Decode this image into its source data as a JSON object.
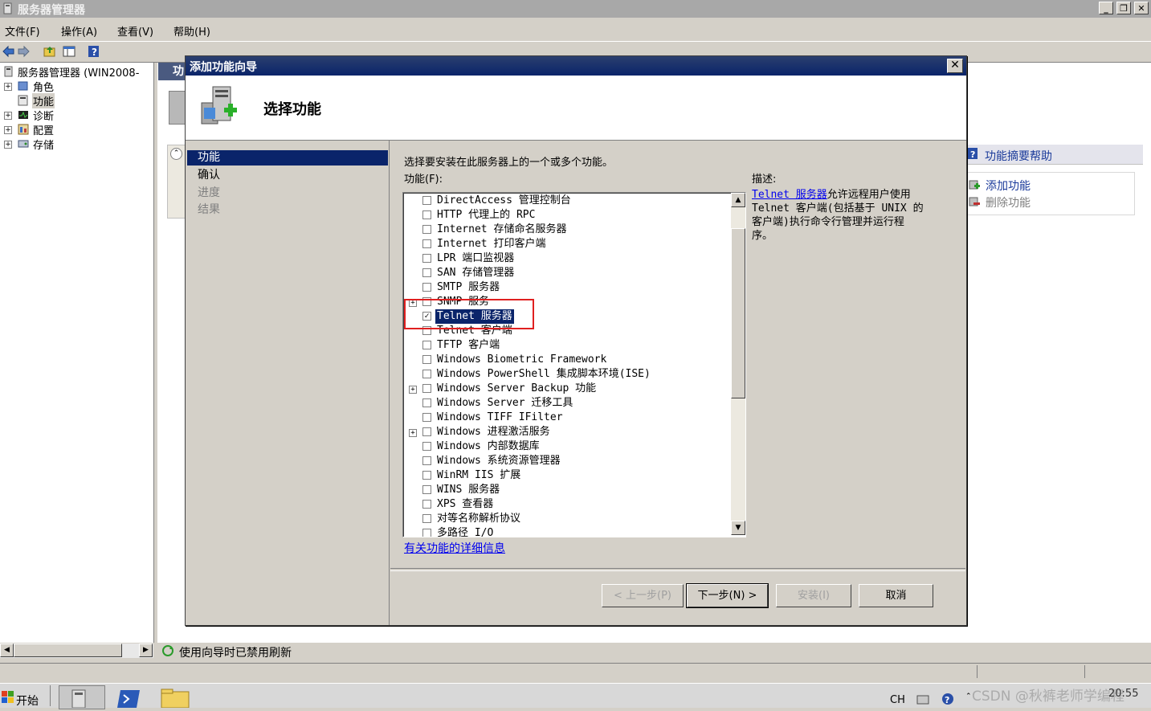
{
  "window": {
    "title": "服务器管理器"
  },
  "menu": [
    "文件(F)",
    "操作(A)",
    "查看(V)",
    "帮助(H)"
  ],
  "tree": {
    "root": "服务器管理器 (WIN2008-",
    "items": [
      "角色",
      "功能",
      "诊断",
      "配置",
      "存储"
    ]
  },
  "content": {
    "header_fragment": "功"
  },
  "actions": {
    "title": "功能摘要帮助",
    "items": [
      "添加功能",
      "删除功能"
    ]
  },
  "status": {
    "text": "使用向导时已禁用刷新"
  },
  "dialog": {
    "title": "添加功能向导",
    "header": "选择功能",
    "steps": [
      "功能",
      "确认",
      "进度",
      "结果"
    ],
    "instruction": "选择要安装在此服务器上的一个或多个功能。",
    "features_label": "功能(F):",
    "features": [
      {
        "label": "DirectAccess 管理控制台",
        "checked": false
      },
      {
        "label": "HTTP 代理上的 RPC",
        "checked": false
      },
      {
        "label": "Internet 存储命名服务器",
        "checked": false
      },
      {
        "label": "Internet 打印客户端",
        "checked": false
      },
      {
        "label": "LPR 端口监视器",
        "checked": false
      },
      {
        "label": "SAN 存储管理器",
        "checked": false
      },
      {
        "label": "SMTP 服务器",
        "checked": false
      },
      {
        "label": "SNMP 服务",
        "checked": false,
        "expandable": true
      },
      {
        "label": "Telnet 服务器",
        "checked": true,
        "selected": true
      },
      {
        "label": "Telnet 客户端",
        "checked": false
      },
      {
        "label": "TFTP 客户端",
        "checked": false
      },
      {
        "label": "Windows Biometric Framework",
        "checked": false
      },
      {
        "label": "Windows PowerShell 集成脚本环境(ISE)",
        "checked": false
      },
      {
        "label": "Windows Server Backup 功能",
        "checked": false,
        "expandable": true
      },
      {
        "label": "Windows Server 迁移工具",
        "checked": false
      },
      {
        "label": "Windows TIFF IFilter",
        "checked": false
      },
      {
        "label": "Windows 进程激活服务",
        "checked": false,
        "expandable": true
      },
      {
        "label": "Windows 内部数据库",
        "checked": false
      },
      {
        "label": "Windows 系统资源管理器",
        "checked": false
      },
      {
        "label": "WinRM IIS 扩展",
        "checked": false
      },
      {
        "label": "WINS 服务器",
        "checked": false
      },
      {
        "label": "XPS 查看器",
        "checked": false
      },
      {
        "label": "对等名称解析协议",
        "checked": false
      },
      {
        "label": "多路径 I/O",
        "checked": false
      }
    ],
    "description_label": "描述:",
    "description_link": "Telnet 服务器",
    "description_lines": [
      "允许远程用户使用",
      "Telnet 客户端(包括基于 UNIX 的",
      "客户端)执行命令行管理并运行程",
      "序。"
    ],
    "more_info_link": "有关功能的详细信息",
    "buttons": {
      "back": "< 上一步(P)",
      "next": "下一步(N) >",
      "install": "安装(I)",
      "cancel": "取消"
    }
  },
  "taskbar": {
    "start": "开始",
    "lang": "CH",
    "clock": "20:55",
    "watermark": "CSDN @秋裤老师学编程"
  }
}
